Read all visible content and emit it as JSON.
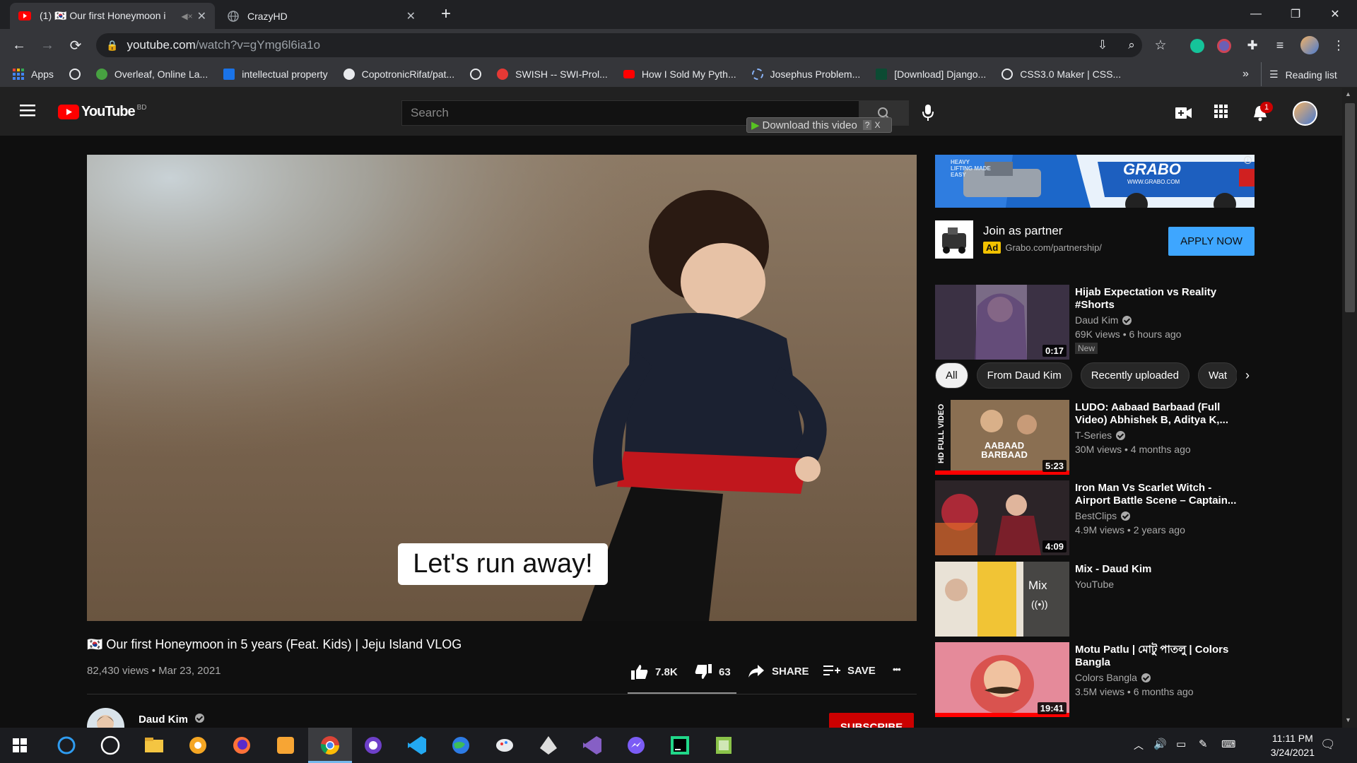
{
  "browser": {
    "tabs": [
      {
        "title": "(1) 🇰🇷 Our first Honeymoon i",
        "active": true,
        "close": "✕"
      },
      {
        "title": "CrazyHD",
        "active": false,
        "close": "✕"
      }
    ],
    "new_tab": "+",
    "window_controls": {
      "minimize": "—",
      "restore": "❐",
      "close": "✕"
    },
    "url_host": "youtube.com",
    "url_path": "/watch?v=gYmg6l6ia1o",
    "bookmarks": [
      {
        "label": "Apps",
        "icon": "apps-grid-icon",
        "color": "#4285f4"
      },
      {
        "label": "",
        "icon": "globe-icon",
        "color": "#e8eaed"
      },
      {
        "label": "Overleaf, Online La...",
        "icon": "overleaf-icon",
        "color": "#47a141"
      },
      {
        "label": "intellectual property",
        "icon": "s-icon",
        "color": "#1a73e8"
      },
      {
        "label": "CopotronicRifat/pat...",
        "icon": "github-icon",
        "color": "#e8eaed"
      },
      {
        "label": "",
        "icon": "globe-icon",
        "color": "#e8eaed"
      },
      {
        "label": "SWISH -- SWI-Prol...",
        "icon": "swish-icon",
        "color": "#e53935"
      },
      {
        "label": "How I Sold My Pyth...",
        "icon": "youtube-icon",
        "color": "#ff0000"
      },
      {
        "label": "Josephus Problem...",
        "icon": "loading-icon",
        "color": "#8ab4f8"
      },
      {
        "label": "[Download] Django...",
        "icon": "django-icon",
        "color": "#0c4b33"
      },
      {
        "label": "CSS3.0 Maker | CSS...",
        "icon": "globe-icon",
        "color": "#e8eaed"
      }
    ],
    "bookmarks_more": "»",
    "reading_list": "Reading list"
  },
  "youtube": {
    "logo_text": "YouTube",
    "logo_region": "BD",
    "search_placeholder": "Search",
    "download_bar": "Download this video",
    "download_bar_help": "?",
    "download_bar_close": "X",
    "notifications_count": "1"
  },
  "video": {
    "caption": "Let's run away!",
    "title": "🇰🇷 Our first Honeymoon in 5 years (Feat. Kids) | Jeju Island VLOG",
    "meta": "82,430 views • Mar 23, 2021",
    "likes": "7.8K",
    "dislikes": "63",
    "share": "SHARE",
    "save": "SAVE",
    "more": "•••",
    "channel": "Daud Kim",
    "subscribe": "SUBSCRIBE"
  },
  "ad": {
    "banner_brand": "GRABO",
    "banner_url": "WWW.GRABO.COM",
    "banner_slogan": "HEAVY LIFTING MADE EASY",
    "title": "Join as partner",
    "badge": "Ad",
    "domain": "Grabo.com/partnership/",
    "cta": "APPLY NOW"
  },
  "chips": [
    "All",
    "From Daud Kim",
    "Recently uploaded",
    "Wat"
  ],
  "recommendations": [
    {
      "title": "Hijab Expectation vs Reality #Shorts",
      "channel": "Daud Kim",
      "verified": true,
      "views": "69K views • 6 hours ago",
      "duration": "0:17",
      "badge": "New",
      "thumb_color": "#6a5a7a"
    },
    {
      "title": "LUDO: Aabaad Barbaad (Full Video) Abhishek B, Aditya K,...",
      "channel": "T-Series",
      "verified": true,
      "views": "30M views • 4 months ago",
      "duration": "5:23",
      "thumb_text": "AABAAD BARBAAD",
      "side_text": "HD FULL VIDEO",
      "thumb_color": "#8a6f52"
    },
    {
      "title": "Iron Man Vs Scarlet Witch - Airport Battle Scene – Captain...",
      "channel": "BestClips",
      "verified": true,
      "views": "4.9M views • 2 years ago",
      "duration": "4:09",
      "thumb_color": "#7a2a34"
    },
    {
      "title": "Mix - Daud Kim",
      "channel": "YouTube",
      "verified": false,
      "views": "",
      "duration": "",
      "mix_label": "Mix",
      "thumb_color": "#c7b9a4"
    },
    {
      "title": "Motu Patlu | মোটু পাতলু | Colors Bangla",
      "channel": "Colors Bangla",
      "verified": true,
      "views": "3.5M views • 6 months ago",
      "duration": "19:41",
      "thumb_color": "#d9534f"
    }
  ],
  "taskbar": {
    "time": "11:11 PM",
    "date": "3/24/2021"
  },
  "colors": {
    "yt_red": "#ff0000",
    "subscribe_red": "#cc0000",
    "apply_blue": "#3ea6ff",
    "ad_badge": "#f2c200"
  }
}
